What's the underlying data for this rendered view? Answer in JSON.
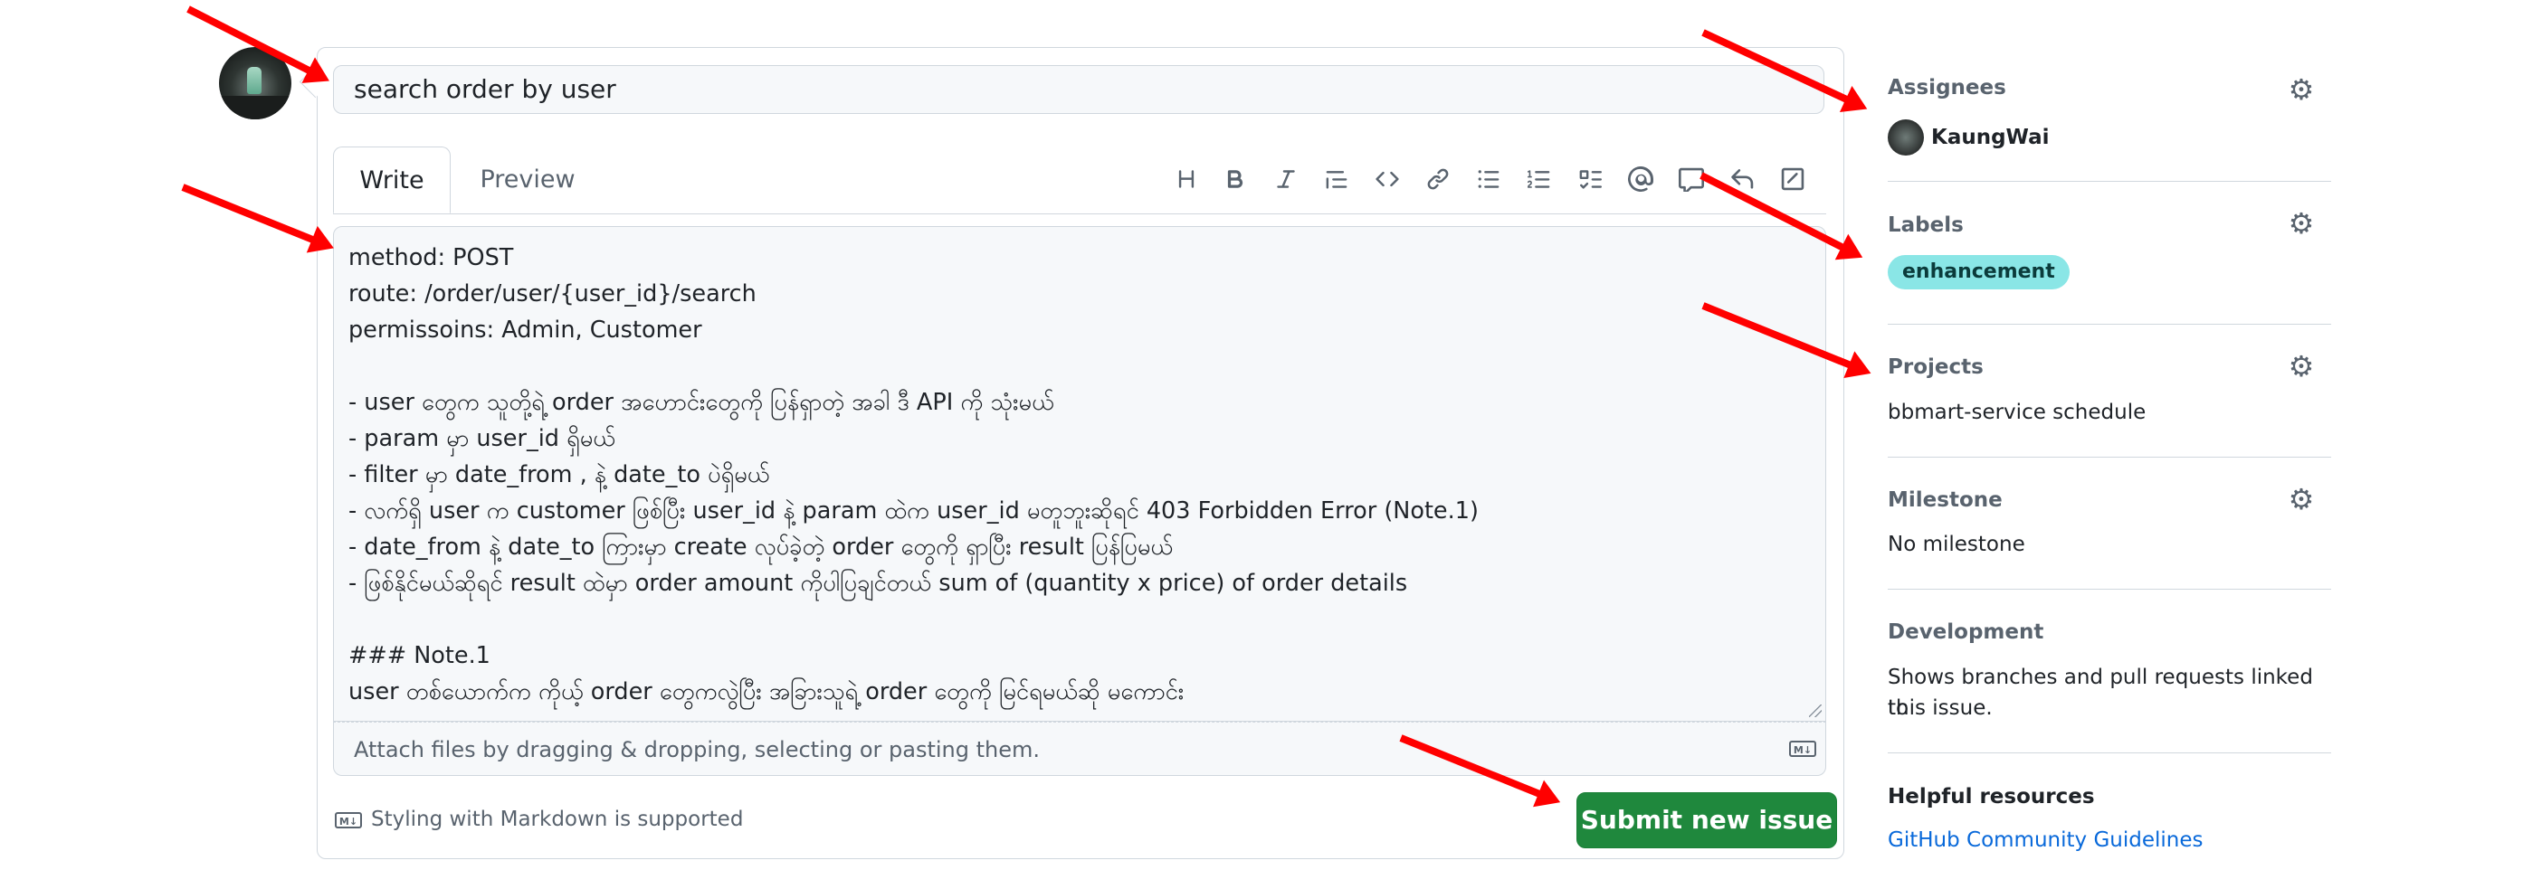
{
  "issue": {
    "title_value": "search order by user",
    "tabs": {
      "write": "Write",
      "preview": "Preview"
    },
    "toolbar_icons": [
      "heading-icon",
      "bold-icon",
      "italic-icon",
      "quote-icon",
      "code-icon",
      "link-icon",
      "unordered-list-icon",
      "ordered-list-icon",
      "task-list-icon",
      "mention-icon",
      "reference-icon",
      "saved-reply-icon",
      "slash-command-icon"
    ],
    "body_lines": [
      "method: POST",
      "route: /order/user/{user_id}/search",
      "permissoins: Admin, Customer",
      "",
      "- user တွေက သူတို့ရဲ့ order အဟောင်းတွေကို ပြန်ရှာတဲ့ အခါ ဒီ API ကို သုံးမယ်",
      "- param မှာ user_id ရှိမယ်",
      "- filter မှာ date_from , နဲ့ date_to ပဲရှိမယ်",
      "- လက်ရှိ user က customer ဖြစ်ပြီး user_id နဲ့ param ထဲက user_id မတူဘူးဆိုရင် 403 Forbidden Error (Note.1)",
      "- date_from နဲ့ date_to ကြားမှာ create လုပ်ခဲ့တဲ့ order တွေကို ရှာပြီး result ပြန်ပြမယ်",
      "- ဖြစ်နိုင်မယ်ဆိုရင် result ထဲမှာ order amount ကိုပါပြချင်တယ် sum of (quantity x price) of order details",
      "",
      "### Note.1",
      "user တစ်ယောက်က ကိုယ့် order တွေကလွဲပြီး အခြားသူရဲ့ order တွေကို မြင်ရမယ်ဆို မကောင်း"
    ],
    "attach_hint": "Attach files by dragging & dropping, selecting or pasting them.",
    "markdown_note": "Styling with Markdown is supported",
    "submit_label": "Submit new issue"
  },
  "sidebar": {
    "assignees": {
      "heading": "Assignees",
      "user": "KaungWai"
    },
    "labels": {
      "heading": "Labels",
      "label": "enhancement",
      "label_color": "#8ae6e6"
    },
    "projects": {
      "heading": "Projects",
      "value": "bbmart-service schedule"
    },
    "milestone": {
      "heading": "Milestone",
      "value": "No milestone"
    },
    "development": {
      "heading": "Development",
      "text_line1": "Shows branches and pull requests linked to",
      "text_line2": "this issue."
    },
    "helpful": {
      "heading": "Helpful resources",
      "link": "GitHub Community Guidelines"
    }
  },
  "colors": {
    "submit": "#1f883d",
    "link": "#0969da",
    "annotation_arrow": "#ff0000"
  }
}
